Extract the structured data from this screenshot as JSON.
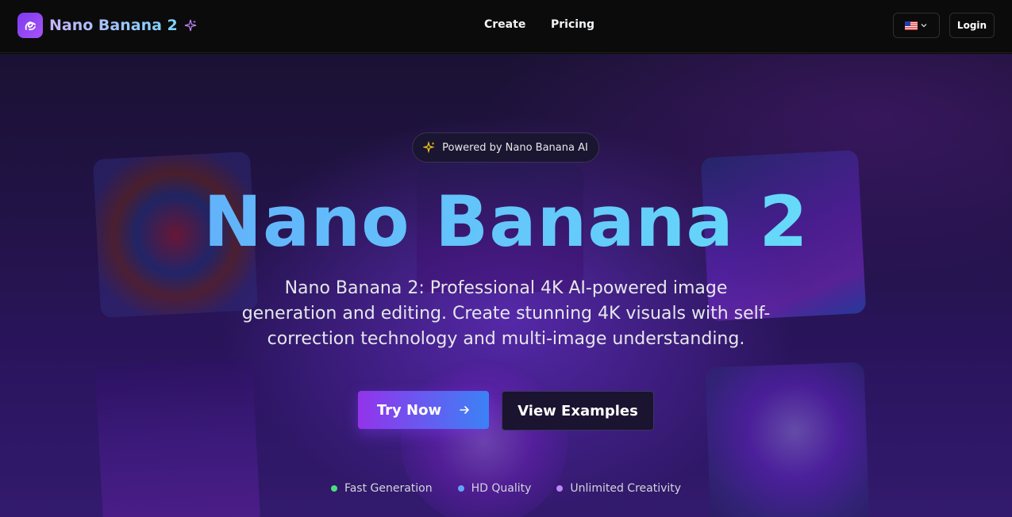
{
  "header": {
    "brand_name": "Nano Banana 2",
    "nav": [
      {
        "label": "Create"
      },
      {
        "label": "Pricing"
      }
    ],
    "login_label": "Login",
    "language_icon": "us-flag-icon"
  },
  "hero": {
    "badge_text": "Powered by Nano Banana AI",
    "title": "Nano Banana 2",
    "subtitle": "Nano Banana 2: Professional 4K AI-powered image generation and editing. Create stunning 4K visuals with self-correction technology and multi-image understanding.",
    "try_now_label": "Try Now",
    "view_examples_label": "View Examples",
    "features": [
      {
        "label": "Fast Generation",
        "color": "#4ade80"
      },
      {
        "label": "HD Quality",
        "color": "#60a5fa"
      },
      {
        "label": "Unlimited Creativity",
        "color": "#c084fc"
      }
    ]
  },
  "colors": {
    "accent_purple": "#9333ea",
    "accent_blue": "#3b82f6",
    "title_gradient_start": "#60a5fa",
    "title_gradient_end": "#67e8f9"
  }
}
